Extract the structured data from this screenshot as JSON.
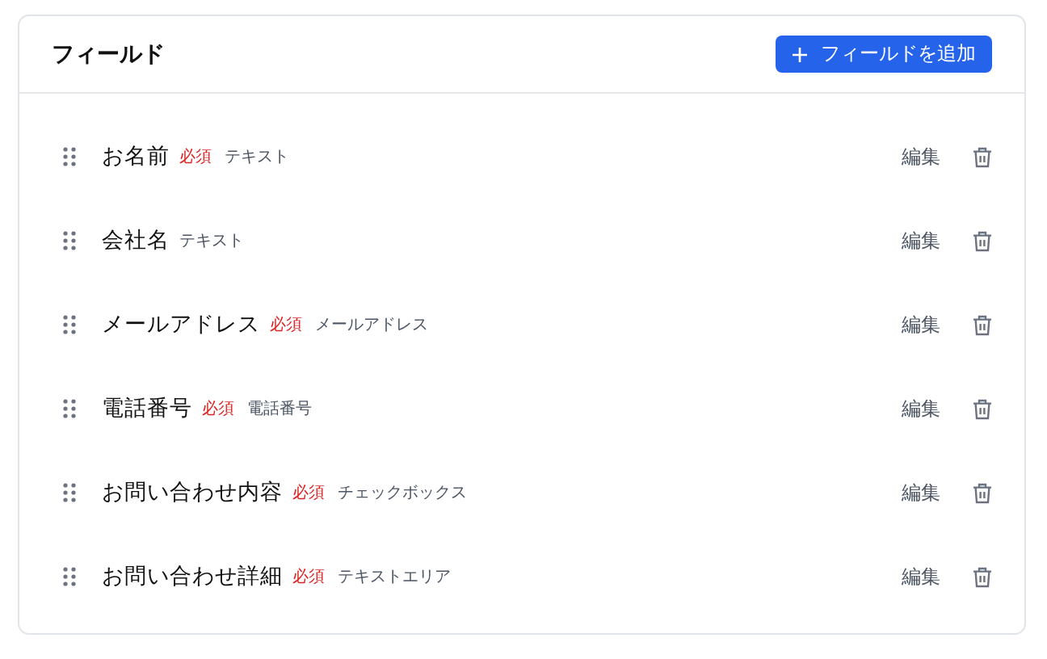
{
  "panel": {
    "title": "フィールド",
    "add_button": "フィールドを追加"
  },
  "fields": [
    {
      "name": "お名前",
      "required_label": "必須",
      "type": "テキスト",
      "edit": "編集"
    },
    {
      "name": "会社名",
      "type": "テキスト",
      "edit": "編集"
    },
    {
      "name": "メールアドレス",
      "required_label": "必須",
      "type": "メールアドレス",
      "edit": "編集"
    },
    {
      "name": "電話番号",
      "required_label": "必須",
      "type": "電話番号",
      "edit": "編集"
    },
    {
      "name": "お問い合わせ内容",
      "required_label": "必須",
      "type": "チェックボックス",
      "edit": "編集"
    },
    {
      "name": "お問い合わせ詳細",
      "required_label": "必須",
      "type": "テキストエリア",
      "edit": "編集"
    }
  ]
}
